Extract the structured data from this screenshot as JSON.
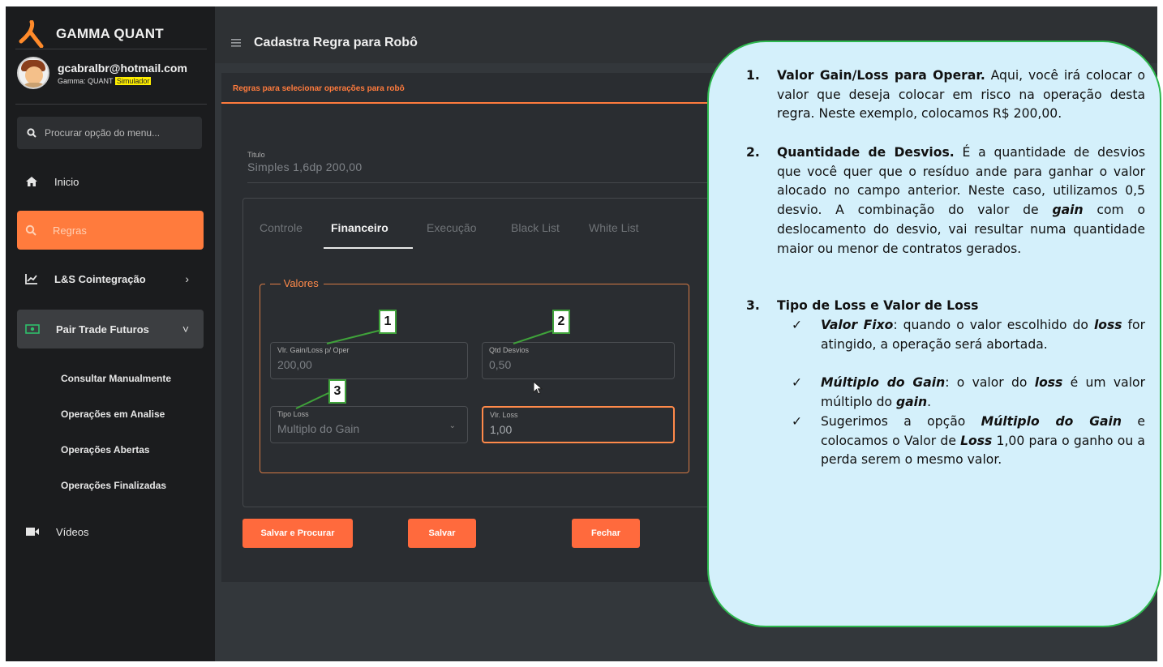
{
  "brand": {
    "title": "GAMMA QUANT"
  },
  "user": {
    "email": "gcabralbr@hotmail.com",
    "plan_prefix": "Gamma: QUANT",
    "plan_badge": "Simulador"
  },
  "search": {
    "placeholder": "Procurar opção do menu..."
  },
  "sidebar": {
    "items": [
      {
        "label": "Inicio",
        "icon": "home-icon"
      },
      {
        "label": "Regras",
        "icon": "search-icon"
      },
      {
        "label": "L&S Cointegração",
        "icon": "chart-line-icon",
        "chevron": "›"
      },
      {
        "label": "Pair Trade Futuros",
        "icon": "money-icon",
        "chevron": "˅"
      },
      {
        "label": "Vídeos",
        "icon": "video-icon"
      }
    ],
    "subitems": [
      "Consultar Manualmente",
      "Operações em Analise",
      "Operações Abertas",
      "Operações Finalizadas"
    ]
  },
  "header": {
    "title": "Cadastra Regra para Robô",
    "menu_icon": "hamburger-icon"
  },
  "card": {
    "header": "Regras para selecionar operações para robô"
  },
  "form": {
    "title_label": "Titulo",
    "title_value": "Simples 1,6dp 200,00",
    "tabs": [
      "Controle",
      "Financeiro",
      "Execução",
      "Black List",
      "White List"
    ],
    "fieldset_legend": "Valores",
    "gain_loss": {
      "label": "Vlr. Gain/Loss p/ Oper",
      "value": "200,00"
    },
    "desvios": {
      "label": "Qtd Desvios",
      "value": "0,50"
    },
    "tipo_loss": {
      "label": "Tipo Loss",
      "value": "Multiplo do Gain"
    },
    "vlr_loss": {
      "label": "Vlr. Loss",
      "value": "1,00"
    }
  },
  "buttons": {
    "save_search": "Salvar e Procurar",
    "save": "Salvar",
    "close": "Fechar"
  },
  "markers": [
    "1",
    "2",
    "3"
  ],
  "colors": {
    "accent": "#ff7b3d",
    "marker_border": "#3fa23a",
    "bubble_bg": "#d4f0fb"
  },
  "annotation": {
    "n1": "1.",
    "n1_title": "Valor Gain/Loss para Operar.",
    "n1_text": " Aqui, você irá colocar o valor que deseja colocar em risco na operação desta regra. Neste exemplo, colocamos R$ 200,00.",
    "n2": "2.",
    "n2_title": "Quantidade de Desvios.",
    "n2_text_a": " É a quantidade de desvios que você quer que o resíduo ande para ganhar o valor alocado no campo anterior. Neste caso, utilizamos 0,5 desvio. A combinação do valor de ",
    "n2_gain": "gain",
    "n2_text_b": " com o deslocamento do desvio, vai resultar numa quantidade maior ou menor de contratos gerados.",
    "n3": "3.",
    "n3_title": "Tipo de Loss e Valor de Loss",
    "check": "✓",
    "c1_title": "Valor Fixo",
    "c1_a": ": quando o valor escolhido do ",
    "c1_loss": "loss",
    "c1_b": " for atingido, a operação será abortada.",
    "c2_title": "Múltiplo do Gain",
    "c2_a": ": o valor do ",
    "c2_loss": "loss",
    "c2_b": " é um valor múltiplo do ",
    "c2_gain": "gain",
    "c2_c": ".",
    "c3_a": "Sugerimos a opção ",
    "c3_opt": "Múltiplo do Gain",
    "c3_b": " e colocamos o Valor de ",
    "c3_loss": "Loss",
    "c3_c": " 1,00 para o ganho ou a perda serem o mesmo valor."
  }
}
